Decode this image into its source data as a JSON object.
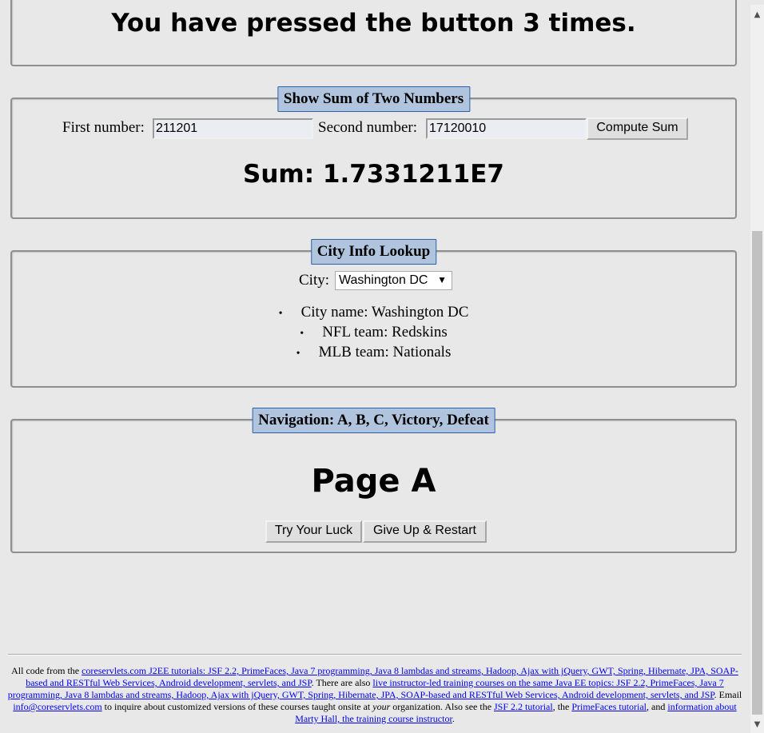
{
  "counter": {
    "message": "You have pressed the button 3 times."
  },
  "sum_panel": {
    "legend": "Show Sum of Two Numbers",
    "first_label": "First number:",
    "first_value": "211201",
    "second_label": "Second number:",
    "second_value": "17120010",
    "compute_label": "Compute Sum",
    "result": "Sum: 1.7331211E7"
  },
  "city_panel": {
    "legend": "City Info Lookup",
    "city_label": "City:",
    "city_selected": "Washington DC",
    "info": [
      "City name: Washington DC",
      "NFL team: Redskins",
      "MLB team: Nationals"
    ]
  },
  "nav_panel": {
    "legend": "Navigation: A, B, C, Victory, Defeat",
    "page_title": "Page A",
    "try_label": "Try Your Luck",
    "give_up_label": "Give Up & Restart"
  },
  "footer": {
    "t1": "All code from the ",
    "l1": "coreservlets.com J2EE tutorials: JSF 2.2, PrimeFaces, Java 7 programming, Java 8 lambdas and streams, Hadoop, Ajax with jQuery, GWT, Spring, Hibernate, JPA, SOAP-based and RESTful Web Services, Android development, servlets, and JSP",
    "t2": ". There are also ",
    "l2": "live instructor-led training courses on the same Java EE topics: JSF 2.2, PrimeFaces, Java 7 programming, Java 8 lambdas and streams, Hadoop, Ajax with jQuery, GWT, Spring, Hibernate, JPA, SOAP-based and RESTful Web Services, Android development, servlets, and JSP",
    "t3": ". Email ",
    "l3": "info@coreservlets.com",
    "t4": " to inquire about customized versions of these courses taught onsite at ",
    "t4_em": "your",
    "t5": " organization. Also see the ",
    "l4": "JSF 2.2 tutorial",
    "t6": ", the ",
    "l5": "PrimeFaces tutorial",
    "t7": ", and ",
    "l6": "information about Marty Hall, the training course instructor",
    "t8": "."
  },
  "icons": {
    "scroll_up": "chevron-up-icon",
    "scroll_down": "chevron-down-icon",
    "dropdown": "caret-down-icon"
  }
}
